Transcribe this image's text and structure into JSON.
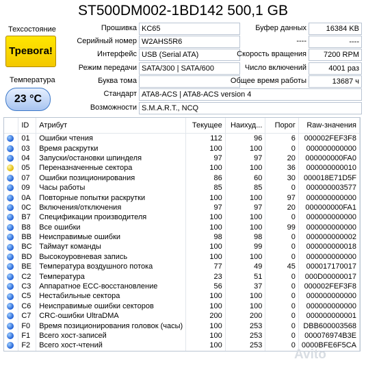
{
  "title": "ST500DM002-1BD142 500,1 GB",
  "left": {
    "status_label": "Техсостояние",
    "status_value": "Тревога!",
    "temp_label": "Температура",
    "temp_value": "23 °C"
  },
  "info": {
    "firmware_label": "Прошивка",
    "firmware_value": "KC65",
    "serial_label": "Серийный номер",
    "serial_value": "W2AHS5R6",
    "interface_label": "Интерфейс",
    "interface_value": "USB (Serial ATA)",
    "transfer_label": "Режим передачи",
    "transfer_value": "SATA/300 | SATA/600",
    "volume_label": "Буква тома",
    "volume_value": "",
    "standard_label": "Стандарт",
    "standard_value": "ATA8-ACS | ATA8-ACS version 4",
    "features_label": "Возможности",
    "features_value": "S.M.A.R.T., NCQ",
    "buffer_label": "Буфер данных",
    "buffer_value": "16384 KB",
    "dash1_label": "----",
    "dash1_value": "----",
    "rpm_label": "Скорость вращения",
    "rpm_value": "7200 RPM",
    "poweron_count_label": "Число включений",
    "poweron_count_value": "4001 раз",
    "hours_label": "Общее время работы",
    "hours_value": "13687 ч"
  },
  "table": {
    "headers": [
      "",
      "ID",
      "Атрибут",
      "Текущее",
      "Наихуд...",
      "Порог",
      "Raw-значения"
    ],
    "rows": [
      {
        "status": "blue",
        "id": "01",
        "name": "Ошибки чтения",
        "cur": "112",
        "worst": "96",
        "thr": "6",
        "raw": "000002FEF3F8"
      },
      {
        "status": "blue",
        "id": "03",
        "name": "Время раскрутки",
        "cur": "100",
        "worst": "100",
        "thr": "0",
        "raw": "000000000000"
      },
      {
        "status": "blue",
        "id": "04",
        "name": "Запуски/остановки шпинделя",
        "cur": "97",
        "worst": "97",
        "thr": "20",
        "raw": "000000000FA0"
      },
      {
        "status": "yellow",
        "id": "05",
        "name": "Переназначенные сектора",
        "cur": "100",
        "worst": "100",
        "thr": "36",
        "raw": "000000000010"
      },
      {
        "status": "blue",
        "id": "07",
        "name": "Ошибки позиционирования",
        "cur": "86",
        "worst": "60",
        "thr": "30",
        "raw": "000018E71D5F"
      },
      {
        "status": "blue",
        "id": "09",
        "name": "Часы работы",
        "cur": "85",
        "worst": "85",
        "thr": "0",
        "raw": "000000003577"
      },
      {
        "status": "blue",
        "id": "0A",
        "name": "Повторные попытки раскрутки",
        "cur": "100",
        "worst": "100",
        "thr": "97",
        "raw": "000000000000"
      },
      {
        "status": "blue",
        "id": "0C",
        "name": "Включения/отключения",
        "cur": "97",
        "worst": "97",
        "thr": "20",
        "raw": "000000000FA1"
      },
      {
        "status": "blue",
        "id": "B7",
        "name": "Спецификации производителя",
        "cur": "100",
        "worst": "100",
        "thr": "0",
        "raw": "000000000000"
      },
      {
        "status": "blue",
        "id": "B8",
        "name": "Все ошибки",
        "cur": "100",
        "worst": "100",
        "thr": "99",
        "raw": "000000000000"
      },
      {
        "status": "blue",
        "id": "BB",
        "name": "Неисправимые ошибки",
        "cur": "98",
        "worst": "98",
        "thr": "0",
        "raw": "000000000002"
      },
      {
        "status": "blue",
        "id": "BC",
        "name": "Таймаут команды",
        "cur": "100",
        "worst": "99",
        "thr": "0",
        "raw": "000000000018"
      },
      {
        "status": "blue",
        "id": "BD",
        "name": "Высокоуровневая запись",
        "cur": "100",
        "worst": "100",
        "thr": "0",
        "raw": "000000000000"
      },
      {
        "status": "blue",
        "id": "BE",
        "name": "Температура воздушного потока",
        "cur": "77",
        "worst": "49",
        "thr": "45",
        "raw": "000017170017"
      },
      {
        "status": "blue",
        "id": "C2",
        "name": "Температура",
        "cur": "23",
        "worst": "51",
        "thr": "0",
        "raw": "000D00000017"
      },
      {
        "status": "blue",
        "id": "C3",
        "name": "Аппаратное ECC-восстановление",
        "cur": "56",
        "worst": "37",
        "thr": "0",
        "raw": "000002FEF3F8"
      },
      {
        "status": "blue",
        "id": "C5",
        "name": "Нестабильные сектора",
        "cur": "100",
        "worst": "100",
        "thr": "0",
        "raw": "000000000000"
      },
      {
        "status": "blue",
        "id": "C6",
        "name": "Неисправимые ошибки секторов",
        "cur": "100",
        "worst": "100",
        "thr": "0",
        "raw": "000000000000"
      },
      {
        "status": "blue",
        "id": "C7",
        "name": "CRC-ошибки UltraDMA",
        "cur": "200",
        "worst": "200",
        "thr": "0",
        "raw": "000000000001"
      },
      {
        "status": "blue",
        "id": "F0",
        "name": "Время позиционирования головок (часы)",
        "cur": "100",
        "worst": "253",
        "thr": "0",
        "raw": "DBB600003568"
      },
      {
        "status": "blue",
        "id": "F1",
        "name": "Всего хост-записей",
        "cur": "100",
        "worst": "253",
        "thr": "0",
        "raw": "000076974B3E"
      },
      {
        "status": "blue",
        "id": "F2",
        "name": "Всего хост-чтений",
        "cur": "100",
        "worst": "253",
        "thr": "0",
        "raw": "0000BFE6F5CA"
      }
    ]
  },
  "watermark": "Avito"
}
